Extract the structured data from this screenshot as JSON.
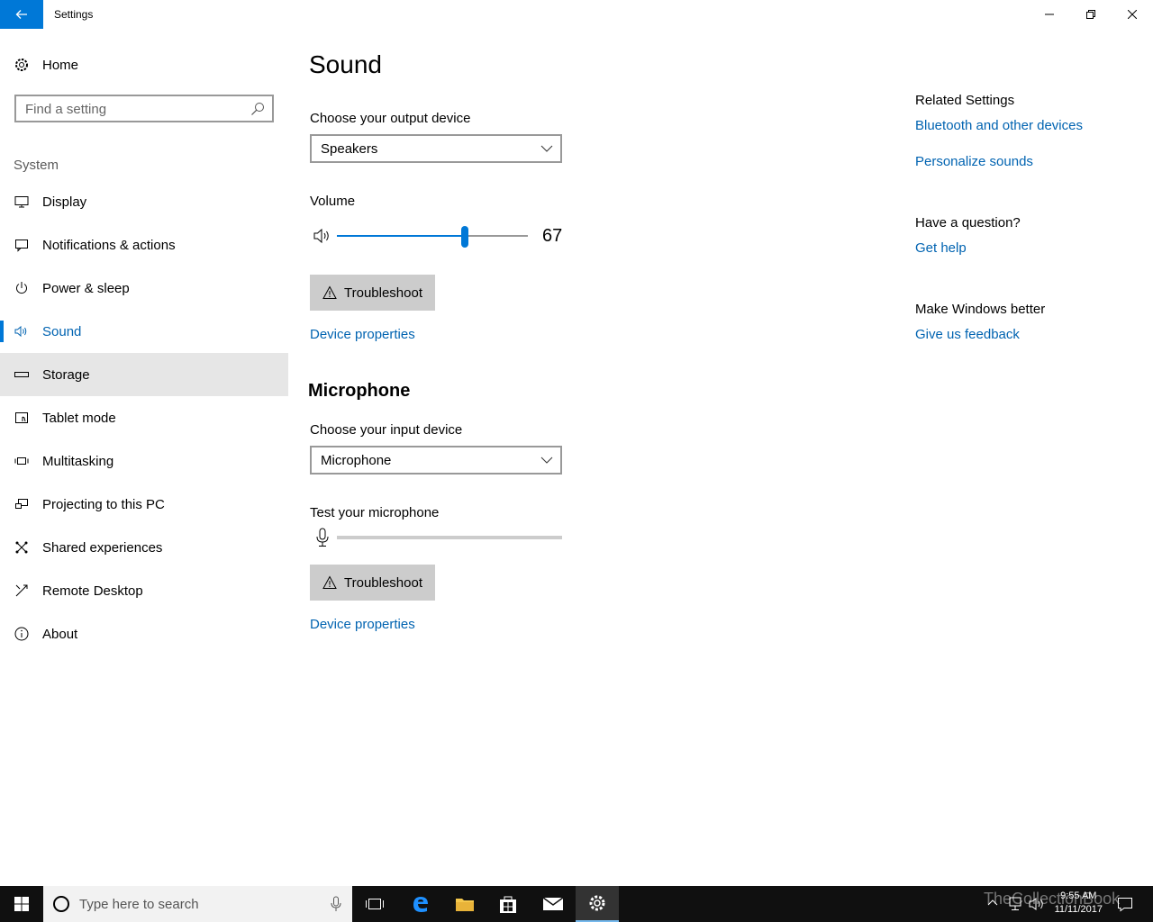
{
  "window": {
    "title": "Settings"
  },
  "sidebar": {
    "home_label": "Home",
    "search_placeholder": "Find a setting",
    "group_label": "System",
    "items": [
      {
        "label": "Display",
        "icon": "display-icon"
      },
      {
        "label": "Notifications & actions",
        "icon": "notifications-icon"
      },
      {
        "label": "Power & sleep",
        "icon": "power-icon"
      },
      {
        "label": "Sound",
        "icon": "sound-icon",
        "selected": true
      },
      {
        "label": "Storage",
        "icon": "storage-icon",
        "hover": true
      },
      {
        "label": "Tablet mode",
        "icon": "tablet-mode-icon"
      },
      {
        "label": "Multitasking",
        "icon": "multitasking-icon"
      },
      {
        "label": "Projecting to this PC",
        "icon": "projecting-icon"
      },
      {
        "label": "Shared experiences",
        "icon": "shared-experiences-icon"
      },
      {
        "label": "Remote Desktop",
        "icon": "remote-desktop-icon"
      },
      {
        "label": "About",
        "icon": "about-icon"
      }
    ]
  },
  "main": {
    "title": "Sound",
    "output": {
      "label": "Choose your output device",
      "selected": "Speakers",
      "volume_label": "Volume",
      "volume_value": "67",
      "volume_level": 67,
      "troubleshoot_label": "Troubleshoot",
      "device_properties_label": "Device properties"
    },
    "microphone": {
      "title": "Microphone",
      "label": "Choose your input device",
      "selected": "Microphone",
      "test_label": "Test your microphone",
      "troubleshoot_label": "Troubleshoot",
      "device_properties_label": "Device properties"
    }
  },
  "related": {
    "heading": "Related Settings",
    "links": [
      "Bluetooth and other devices",
      "Personalize sounds"
    ],
    "question_heading": "Have a question?",
    "help_link": "Get help",
    "feedback_heading": "Make Windows better",
    "feedback_link": "Give us feedback"
  },
  "taskbar": {
    "search_placeholder": "Type here to search",
    "time": "9:55 AM",
    "date": "11/11/2017",
    "watermark": "TheCollectionBook"
  },
  "colors": {
    "accent": "#0078d7",
    "link": "#0063b1",
    "hover": "#e6e6e6"
  }
}
